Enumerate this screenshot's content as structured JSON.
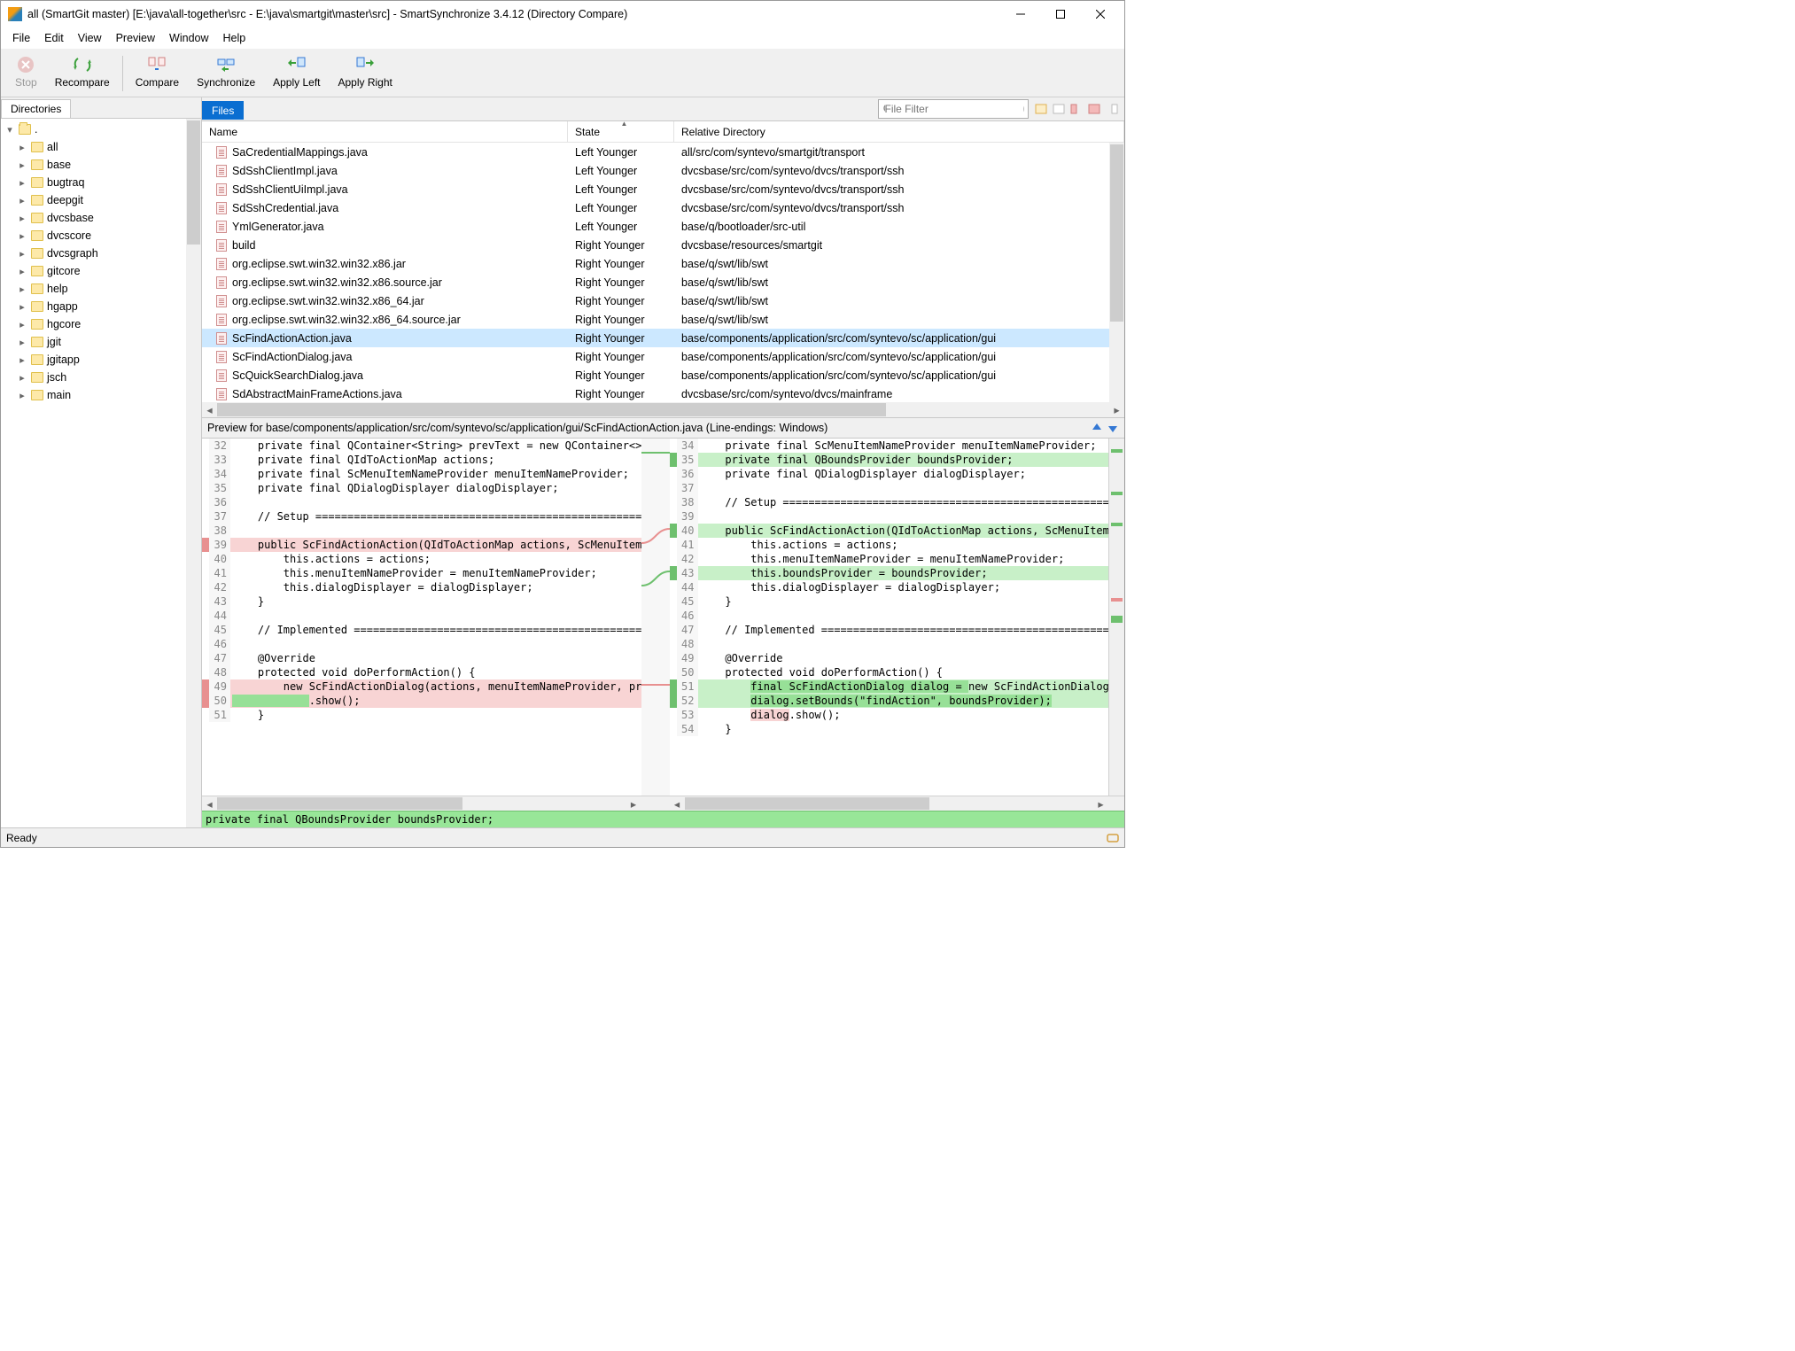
{
  "titlebar": {
    "title": "all (SmartGit master) [E:\\java\\all-together\\src - E:\\java\\smartgit\\master\\src] - SmartSynchronize 3.4.12 (Directory Compare)"
  },
  "menubar": [
    "File",
    "Edit",
    "View",
    "Preview",
    "Window",
    "Help"
  ],
  "toolbar": [
    {
      "id": "stop",
      "label": "Stop",
      "disabled": true
    },
    {
      "id": "recompare",
      "label": "Recompare"
    },
    {
      "sep": true
    },
    {
      "id": "compare",
      "label": "Compare"
    },
    {
      "id": "synchronize",
      "label": "Synchronize"
    },
    {
      "id": "apply-left",
      "label": "Apply Left"
    },
    {
      "id": "apply-right",
      "label": "Apply Right"
    }
  ],
  "left_tab": "Directories",
  "right_tab": "Files",
  "tree_root": ".",
  "tree": [
    "all",
    "base",
    "bugtraq",
    "deepgit",
    "dvcsbase",
    "dvcscore",
    "dvcsgraph",
    "gitcore",
    "help",
    "hgapp",
    "hgcore",
    "jgit",
    "jgitapp",
    "jsch",
    "main"
  ],
  "file_filter_placeholder": "File Filter",
  "columns": {
    "name": "Name",
    "state": "State",
    "reldir": "Relative Directory"
  },
  "files": [
    {
      "name": "SaCredentialMappings.java",
      "state": "Left Younger",
      "reldir": "all/src/com/syntevo/smartgit/transport"
    },
    {
      "name": "SdSshClientImpl.java",
      "state": "Left Younger",
      "reldir": "dvcsbase/src/com/syntevo/dvcs/transport/ssh"
    },
    {
      "name": "SdSshClientUiImpl.java",
      "state": "Left Younger",
      "reldir": "dvcsbase/src/com/syntevo/dvcs/transport/ssh"
    },
    {
      "name": "SdSshCredential.java",
      "state": "Left Younger",
      "reldir": "dvcsbase/src/com/syntevo/dvcs/transport/ssh"
    },
    {
      "name": "YmlGenerator.java",
      "state": "Left Younger",
      "reldir": "base/q/bootloader/src-util"
    },
    {
      "name": "build",
      "state": "Right Younger",
      "reldir": "dvcsbase/resources/smartgit"
    },
    {
      "name": "org.eclipse.swt.win32.win32.x86.jar",
      "state": "Right Younger",
      "reldir": "base/q/swt/lib/swt"
    },
    {
      "name": "org.eclipse.swt.win32.win32.x86.source.jar",
      "state": "Right Younger",
      "reldir": "base/q/swt/lib/swt"
    },
    {
      "name": "org.eclipse.swt.win32.win32.x86_64.jar",
      "state": "Right Younger",
      "reldir": "base/q/swt/lib/swt"
    },
    {
      "name": "org.eclipse.swt.win32.win32.x86_64.source.jar",
      "state": "Right Younger",
      "reldir": "base/q/swt/lib/swt"
    },
    {
      "name": "ScFindActionAction.java",
      "state": "Right Younger",
      "reldir": "base/components/application/src/com/syntevo/sc/application/gui",
      "selected": true
    },
    {
      "name": "ScFindActionDialog.java",
      "state": "Right Younger",
      "reldir": "base/components/application/src/com/syntevo/sc/application/gui"
    },
    {
      "name": "ScQuickSearchDialog.java",
      "state": "Right Younger",
      "reldir": "base/components/application/src/com/syntevo/sc/application/gui"
    },
    {
      "name": "SdAbstractMainFrameActions.java",
      "state": "Right Younger",
      "reldir": "dvcsbase/src/com/syntevo/dvcs/mainframe"
    }
  ],
  "preview_header": "Preview for base/components/application/src/com/syntevo/sc/application/gui/ScFindActionAction.java (Line-endings: Windows)",
  "diff_left": [
    {
      "n": 32,
      "t": "    private final QContainer<String> prevText = new QContainer<>();"
    },
    {
      "n": 33,
      "t": "    private final QIdToActionMap actions;"
    },
    {
      "n": 34,
      "t": "    private final ScMenuItemNameProvider menuItemNameProvider;"
    },
    {
      "n": 35,
      "t": "    private final QDialogDisplayer dialogDisplayer;"
    },
    {
      "n": 36,
      "t": ""
    },
    {
      "n": 37,
      "t": "    // Setup ================================================================"
    },
    {
      "n": 38,
      "t": ""
    },
    {
      "n": 39,
      "t": "    public ScFindActionAction(QIdToActionMap actions, ScMenuItemNameProvide",
      "c": "deleted"
    },
    {
      "n": 40,
      "t": "        this.actions = actions;"
    },
    {
      "n": 41,
      "t": "        this.menuItemNameProvider = menuItemNameProvider;"
    },
    {
      "n": 42,
      "t": "        this.dialogDisplayer = dialogDisplayer;"
    },
    {
      "n": 43,
      "t": "    }"
    },
    {
      "n": 44,
      "t": ""
    },
    {
      "n": 45,
      "t": "    // Implemented ==========================================================="
    },
    {
      "n": 46,
      "t": ""
    },
    {
      "n": 47,
      "t": "    @Override"
    },
    {
      "n": 48,
      "t": "    protected void doPerformAction() {"
    },
    {
      "n": 49,
      "t": "        new ScFindActionDialog(actions, menuItemNameProvider, prevText, dia",
      "c": "deleted"
    },
    {
      "n": 50,
      "t": "            .show();",
      "c": "deleted",
      "hl": [
        "            "
      ]
    },
    {
      "n": 51,
      "t": "    }"
    }
  ],
  "diff_right": [
    {
      "n": 34,
      "t": "    private final ScMenuItemNameProvider menuItemNameProvider;"
    },
    {
      "n": 35,
      "t": "    private final QBoundsProvider boundsProvider;",
      "c": "added"
    },
    {
      "n": 36,
      "t": "    private final QDialogDisplayer dialogDisplayer;"
    },
    {
      "n": 37,
      "t": ""
    },
    {
      "n": 38,
      "t": "    // Setup ================================================================"
    },
    {
      "n": 39,
      "t": ""
    },
    {
      "n": 40,
      "t": "    public ScFindActionAction(QIdToActionMap actions, ScMenuItemNameProvide",
      "c": "added"
    },
    {
      "n": 41,
      "t": "        this.actions = actions;"
    },
    {
      "n": 42,
      "t": "        this.menuItemNameProvider = menuItemNameProvider;"
    },
    {
      "n": 43,
      "t": "        this.boundsProvider = boundsProvider;",
      "c": "added"
    },
    {
      "n": 44,
      "t": "        this.dialogDisplayer = dialogDisplayer;"
    },
    {
      "n": 45,
      "t": "    }"
    },
    {
      "n": 46,
      "t": ""
    },
    {
      "n": 47,
      "t": "    // Implemented ==========================================================="
    },
    {
      "n": 48,
      "t": ""
    },
    {
      "n": 49,
      "t": "    @Override"
    },
    {
      "n": 50,
      "t": "    protected void doPerformAction() {"
    },
    {
      "n": 51,
      "t": "        final ScFindActionDialog dialog = new ScFindActionDialog(actions, me",
      "c": "added",
      "hl": [
        "final ScFindActionDialog dialog = "
      ]
    },
    {
      "n": 52,
      "t": "        dialog.setBounds(\"findAction\", boundsProvider);",
      "c": "added",
      "hl": [
        "dialog.setBounds(\"findAction\", boundsProvider);"
      ]
    },
    {
      "n": 53,
      "t": "        dialog.show();",
      "hlpink": [
        "dialog"
      ]
    },
    {
      "n": 54,
      "t": "    }"
    }
  ],
  "footer_line": "  private final QBoundsProvider boundsProvider;",
  "status": "Ready"
}
